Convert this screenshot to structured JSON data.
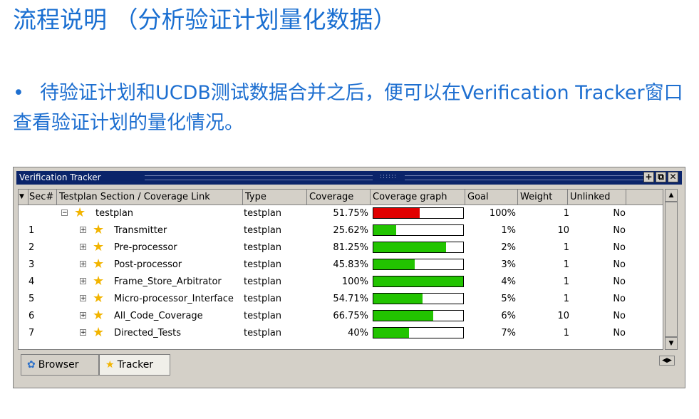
{
  "slide": {
    "title": "流程说明  （分析验证计划量化数据）",
    "bullet_mark": "•",
    "bullet_text": "待验证计划和UCDB测试数据合并之后，便可以在Verification Tracker窗口查看验证计划的量化情况。"
  },
  "window": {
    "title": "Verification Tracker",
    "buttons": [
      "+",
      "⧉",
      "✕"
    ]
  },
  "columns": [
    "Sec#",
    "Testplan Section / Coverage Link",
    "Type",
    "Coverage",
    "Coverage graph",
    "Goal",
    "Weight",
    "Unlinked"
  ],
  "rows": [
    {
      "num": "",
      "name": "testplan",
      "type": "testplan",
      "coverage_text": "51.75%",
      "coverage": 51.75,
      "bar_color": "#e00000",
      "goal": "100%",
      "weight": "1",
      "unlinked": "No",
      "expander": "−",
      "indent": 0
    },
    {
      "num": "1",
      "name": "Transmitter",
      "type": "testplan",
      "coverage_text": "25.62%",
      "coverage": 25.62,
      "bar_color": "#22c400",
      "goal": "1%",
      "weight": "10",
      "unlinked": "No",
      "expander": "+",
      "indent": 1
    },
    {
      "num": "2",
      "name": "Pre-processor",
      "type": "testplan",
      "coverage_text": "81.25%",
      "coverage": 81.25,
      "bar_color": "#22c400",
      "goal": "2%",
      "weight": "1",
      "unlinked": "No",
      "expander": "+",
      "indent": 1
    },
    {
      "num": "3",
      "name": "Post-processor",
      "type": "testplan",
      "coverage_text": "45.83%",
      "coverage": 45.83,
      "bar_color": "#22c400",
      "goal": "3%",
      "weight": "1",
      "unlinked": "No",
      "expander": "+",
      "indent": 1
    },
    {
      "num": "4",
      "name": "Frame_Store_Arbitrator",
      "type": "testplan",
      "coverage_text": "100%",
      "coverage": 100,
      "bar_color": "#22c400",
      "goal": "4%",
      "weight": "1",
      "unlinked": "No",
      "expander": "+",
      "indent": 1
    },
    {
      "num": "5",
      "name": "Micro-processor_Interface",
      "type": "testplan",
      "coverage_text": "54.71%",
      "coverage": 54.71,
      "bar_color": "#22c400",
      "goal": "5%",
      "weight": "1",
      "unlinked": "No",
      "expander": "+",
      "indent": 1
    },
    {
      "num": "6",
      "name": "All_Code_Coverage",
      "type": "testplan",
      "coverage_text": "66.75%",
      "coverage": 66.75,
      "bar_color": "#22c400",
      "goal": "6%",
      "weight": "10",
      "unlinked": "No",
      "expander": "+",
      "indent": 1
    },
    {
      "num": "7",
      "name": "Directed_Tests",
      "type": "testplan",
      "coverage_text": "40%",
      "coverage": 40,
      "bar_color": "#22c400",
      "goal": "7%",
      "weight": "1",
      "unlinked": "No",
      "expander": "+",
      "indent": 1
    }
  ],
  "tabs": [
    {
      "label": "Browser",
      "icon": "browser-icon",
      "active": false
    },
    {
      "label": "Tracker",
      "icon": "star-icon",
      "active": true
    }
  ],
  "colors": {
    "accent": "#1a6fd1",
    "titlebar": "#0a246a",
    "bar_fail": "#e00000",
    "bar_pass": "#22c400"
  }
}
